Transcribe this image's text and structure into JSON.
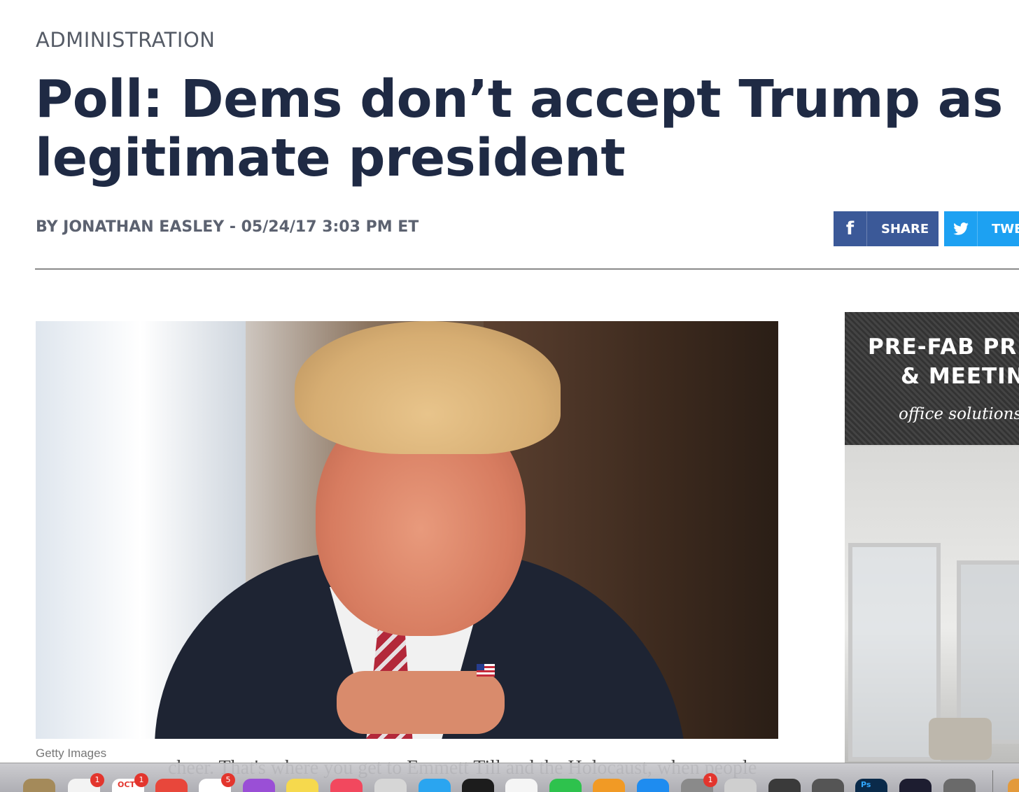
{
  "article": {
    "section": "ADMINISTRATION",
    "headline": "Poll: Dems don’t accept Trump as legitimate president",
    "byline": "BY JONATHAN EASLEY - 05/24/17 3:03 PM ET",
    "image_caption": "Getty Images",
    "body_fragment": "cheer. That's where you get to Emmett Till and the Holocaust, when people"
  },
  "share": {
    "facebook_label": "SHARE",
    "twitter_label": "TWE",
    "facebook_icon": "f",
    "twitter_icon": "🐦"
  },
  "ad": {
    "line1": "PRE-FAB PR",
    "line2": "& MEETIN",
    "tagline": "office solutions fo"
  },
  "dock": {
    "items": [
      {
        "name": "dock-app-1",
        "color": "#a48a5a",
        "badge": ""
      },
      {
        "name": "dock-app-photos",
        "color": "#f3f3f3",
        "badge": "1"
      },
      {
        "name": "dock-app-calendar",
        "color": "#ffffff",
        "badge": "1",
        "label": "OCT"
      },
      {
        "name": "dock-app-news",
        "color": "#e8473b",
        "badge": ""
      },
      {
        "name": "dock-app-reminders",
        "color": "#ffffff",
        "badge": "5"
      },
      {
        "name": "dock-app-podcasts",
        "color": "#9a4fd6",
        "badge": ""
      },
      {
        "name": "dock-app-notes",
        "color": "#f6d94d",
        "badge": ""
      },
      {
        "name": "dock-app-music",
        "color": "#f2485e",
        "badge": ""
      },
      {
        "name": "dock-app-preview",
        "color": "#d6d6d6",
        "badge": ""
      },
      {
        "name": "dock-app-appstore",
        "color": "#2aa5f0",
        "badge": ""
      },
      {
        "name": "dock-app-stocks",
        "color": "#1c1c1c",
        "badge": ""
      },
      {
        "name": "dock-app-appnews",
        "color": "#f5f5f5",
        "badge": ""
      },
      {
        "name": "dock-app-numbers",
        "color": "#2ec24d",
        "badge": ""
      },
      {
        "name": "dock-app-pages",
        "color": "#f19a25",
        "badge": ""
      },
      {
        "name": "dock-app-xcode",
        "color": "#1e8cf0",
        "badge": ""
      },
      {
        "name": "dock-app-settings",
        "color": "#8a8a8a",
        "badge": "1"
      },
      {
        "name": "dock-app-generic",
        "color": "#cfcfcf",
        "badge": ""
      },
      {
        "name": "dock-app-quicktime",
        "color": "#3a3a3a",
        "badge": ""
      },
      {
        "name": "dock-app-camera",
        "color": "#555555",
        "badge": ""
      },
      {
        "name": "dock-app-photoshop",
        "color": "#0a2a4a",
        "badge": "",
        "label": "Ps"
      },
      {
        "name": "dock-app-lightroom",
        "color": "#1d1d30",
        "badge": ""
      },
      {
        "name": "dock-app-automator",
        "color": "#6a6a6a",
        "badge": ""
      },
      {
        "name": "dock-app-downloads",
        "color": "#e39a3b",
        "badge": ""
      }
    ]
  }
}
